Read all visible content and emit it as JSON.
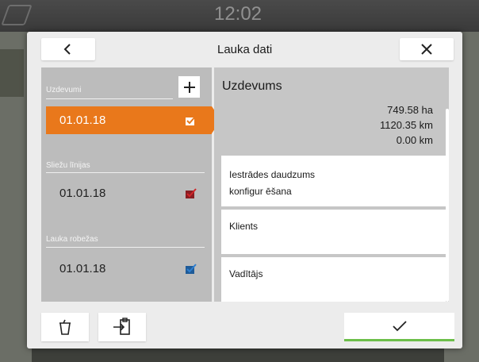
{
  "status_bar": {
    "time": "12:02"
  },
  "dialog": {
    "title": "Lauka dati",
    "back_icon": "chevron-left-icon",
    "close_icon": "close-icon"
  },
  "left": {
    "sections": [
      {
        "label": "Uzdevumi",
        "item": "01.01.18",
        "selected": true,
        "checkbox_color": "#ffffff"
      },
      {
        "label": "Sliežu līnijas",
        "item": "01.01.18",
        "selected": false,
        "checkbox_color": "#d0262a"
      },
      {
        "label": "Lauka robežas",
        "item": "01.01.18",
        "selected": false,
        "checkbox_color": "#2f7fd0"
      }
    ],
    "add_icon": "plus-icon"
  },
  "detail": {
    "title": "Uzdevums",
    "stats": [
      "749.58 ha",
      "1120.35 km",
      "0.00 km"
    ],
    "cards": [
      {
        "line1": "Iestrādes daudzums",
        "line2": "konfigur ēšana"
      },
      {
        "line1": "Klients"
      },
      {
        "line1": "Vadītājs"
      }
    ]
  },
  "footer": {
    "delete_icon": "trash-icon",
    "export_icon": "export-icon",
    "confirm_icon": "checkmark-icon"
  },
  "colors": {
    "accent": "#e9781b",
    "confirm": "#6cbf4a"
  }
}
